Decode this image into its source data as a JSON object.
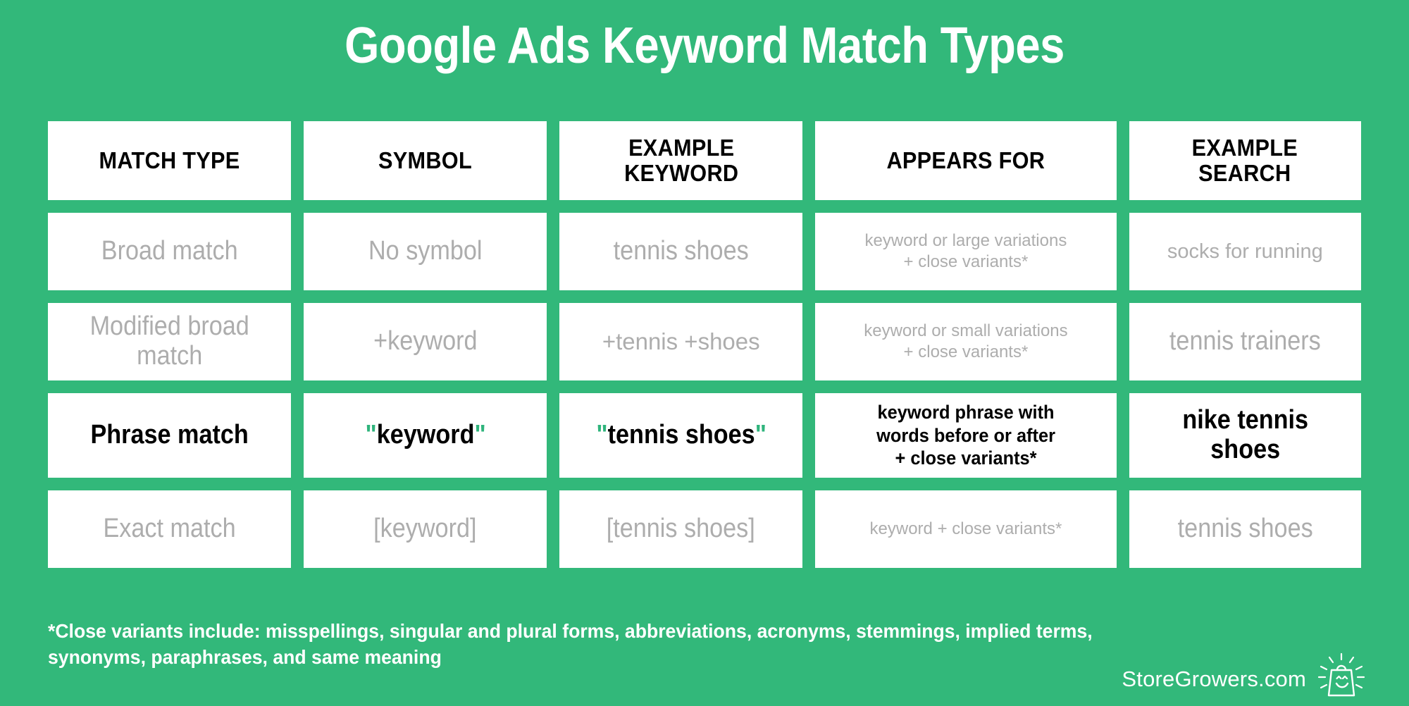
{
  "title": "Google Ads Keyword Match Types",
  "colors": {
    "background_green": "#32b87a",
    "cell_white": "#ffffff",
    "muted_text": "#adadad",
    "emphasis_text": "#000000",
    "accent_quote_green": "#2fb47c"
  },
  "table": {
    "headers": [
      "MATCH TYPE",
      "SYMBOL",
      "EXAMPLE\nKEYWORD",
      "APPEARS FOR",
      "EXAMPLE\nSEARCH"
    ],
    "rows": [
      {
        "highlighted": false,
        "match_type": "Broad match",
        "symbol": "No symbol",
        "example_keyword": "tennis shoes",
        "appears_for": "keyword or large variations\n+ close variants*",
        "example_search": "socks for running"
      },
      {
        "highlighted": false,
        "match_type": "Modified broad\nmatch",
        "symbol": "+keyword",
        "example_keyword": "+tennis +shoes",
        "appears_for": "keyword or small variations\n+ close variants*",
        "example_search": "tennis trainers"
      },
      {
        "highlighted": true,
        "match_type": "Phrase match",
        "symbol_quote_open": "\"",
        "symbol_core": "keyword",
        "symbol_quote_close": "\"",
        "symbol": "\"keyword\"",
        "example_keyword_quote_open": "\"",
        "example_keyword_core": "tennis shoes",
        "example_keyword_quote_close": "\"",
        "example_keyword": "\"tennis shoes\"",
        "appears_for": "keyword phrase with\nwords before or after\n+ close variants*",
        "example_search": "nike tennis shoes"
      },
      {
        "highlighted": false,
        "match_type": "Exact match",
        "symbol": "[keyword]",
        "example_keyword": "[tennis shoes]",
        "appears_for": "keyword + close variants*",
        "example_search": "tennis shoes"
      }
    ]
  },
  "footnote": "*Close variants include: misspellings, singular and plural forms, abbreviations, acronyms, stemmings, implied terms, synonyms, paraphrases, and same meaning",
  "logo": {
    "text": "StoreGrowers.com",
    "icon": "shopping-bag-smile-icon"
  }
}
